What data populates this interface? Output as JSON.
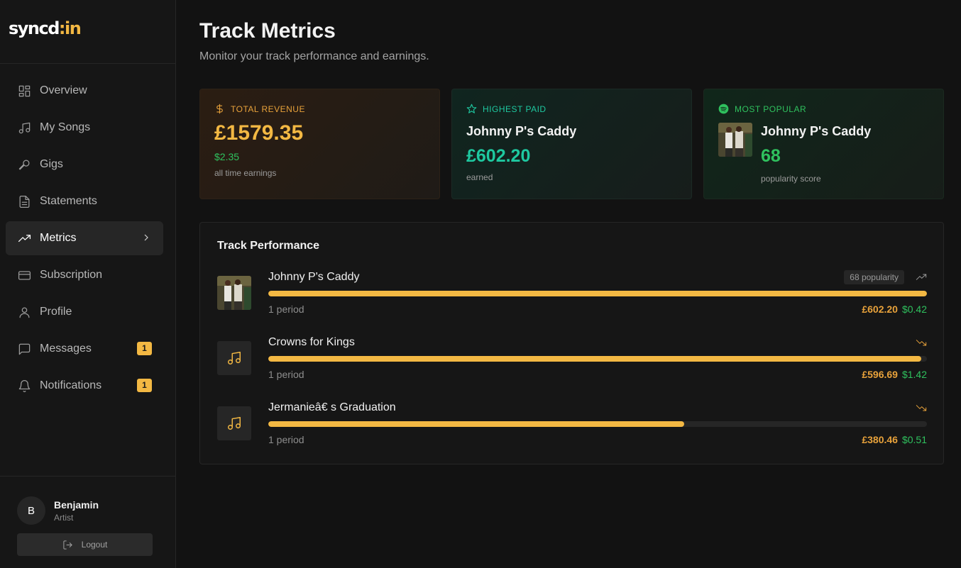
{
  "app": {
    "logo_main": "syncd",
    "logo_accent": ":in"
  },
  "sidebar": {
    "items": [
      {
        "label": "Overview",
        "icon": "grid-icon"
      },
      {
        "label": "My Songs",
        "icon": "music-note-icon"
      },
      {
        "label": "Gigs",
        "icon": "microphone-icon"
      },
      {
        "label": "Statements",
        "icon": "document-icon"
      },
      {
        "label": "Metrics",
        "icon": "trending-up-icon",
        "active": true
      },
      {
        "label": "Subscription",
        "icon": "credit-card-icon"
      },
      {
        "label": "Profile",
        "icon": "user-icon"
      },
      {
        "label": "Messages",
        "icon": "message-icon",
        "badge": "1"
      },
      {
        "label": "Notifications",
        "icon": "bell-icon",
        "badge": "1"
      }
    ]
  },
  "user": {
    "initial": "B",
    "name": "Benjamin",
    "role": "Artist",
    "logout_label": "Logout"
  },
  "page": {
    "title": "Track Metrics",
    "subtitle": "Monitor your track performance and earnings."
  },
  "cards": {
    "revenue": {
      "label": "TOTAL REVENUE",
      "amount": "£1579.35",
      "sub": "$2.35",
      "note": "all time earnings"
    },
    "paid": {
      "label": "HIGHEST PAID",
      "track": "Johnny P's Caddy",
      "amount": "£602.20",
      "note": "earned"
    },
    "popular": {
      "label": "MOST POPULAR",
      "track": "Johnny P's Caddy",
      "score": "68",
      "note": "popularity score"
    }
  },
  "performance": {
    "title": "Track Performance",
    "tracks": [
      {
        "name": "Johnny P's Caddy",
        "popularity": "68 popularity",
        "period": "1 period",
        "gbp": "£602.20",
        "usd": "$0.42",
        "progress": 1.0,
        "trend": "up"
      },
      {
        "name": "Crowns for Kings",
        "period": "1 period",
        "gbp": "£596.69",
        "usd": "$1.42",
        "progress": 0.991,
        "trend": "down"
      },
      {
        "name": "Jermanieâ€ s Graduation",
        "period": "1 period",
        "gbp": "£380.46",
        "usd": "$0.51",
        "progress": 0.632,
        "trend": "down"
      }
    ]
  },
  "colors": {
    "accent": "#f3b843",
    "green": "#2fc15e",
    "teal": "#1ec8a0",
    "orange": "#e8a23b"
  }
}
